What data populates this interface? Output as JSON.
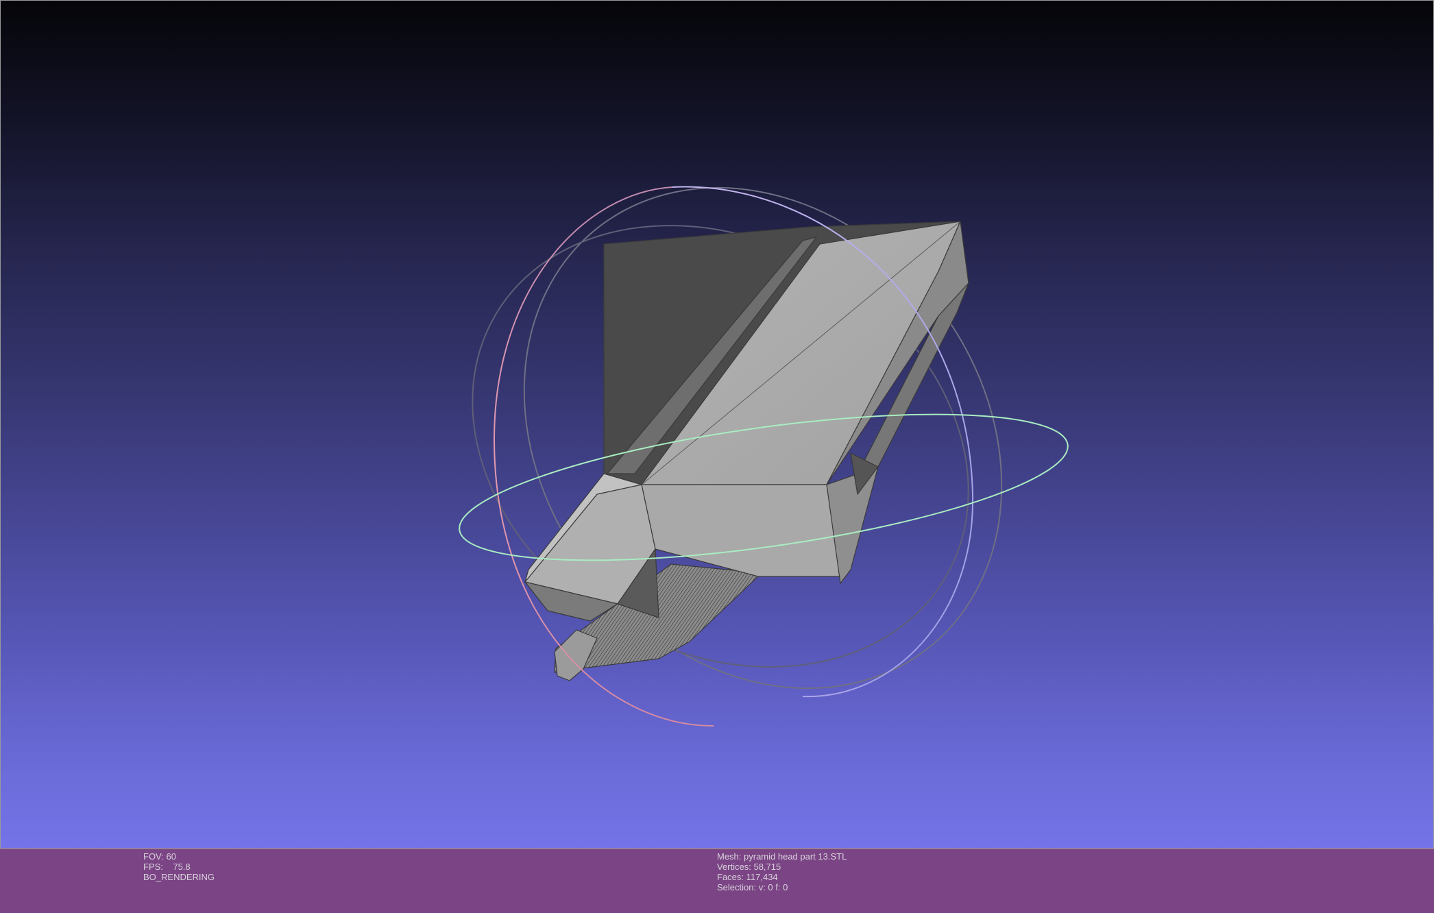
{
  "viewer": {
    "colors": {
      "background_top": "#050509",
      "background_bottom": "#7474e8",
      "mesh_face": "#a9a9a9",
      "mesh_edge": "#3a3a3a",
      "info_bar": "#7b4585",
      "trackball_x": "#e49ab0",
      "trackball_y": "#a9ecc2",
      "trackball_z": "#b7b3f0"
    }
  },
  "info": {
    "left": {
      "fov": "FOV: 60",
      "fps": "FPS:    75.8",
      "render_mode": "BO_RENDERING"
    },
    "right": {
      "mesh": "Mesh: pyramid head part 13.STL",
      "vertices": "Vertices: 58,715",
      "faces": "Faces: 117,434",
      "selection": "Selection: v: 0 f: 0"
    }
  }
}
